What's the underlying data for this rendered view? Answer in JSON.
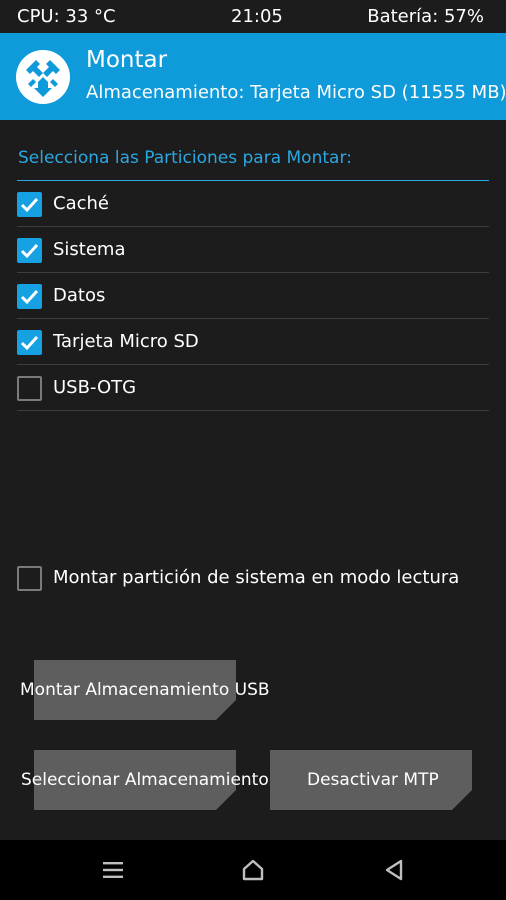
{
  "status_bar": {
    "cpu": "CPU: 33 °C",
    "time": "21:05",
    "battery": "Batería: 57%"
  },
  "header": {
    "title": "Montar",
    "subtitle": "Almacenamiento: Tarjeta Micro SD (11555 MB)",
    "logo_icon": "twrp-logo-icon"
  },
  "partitions": {
    "label": "Selecciona las Particiones para Montar:",
    "items": [
      {
        "label": "Caché",
        "checked": true
      },
      {
        "label": "Sistema",
        "checked": true
      },
      {
        "label": "Datos",
        "checked": true
      },
      {
        "label": "Tarjeta Micro SD",
        "checked": true
      },
      {
        "label": "USB-OTG",
        "checked": false
      }
    ]
  },
  "readonly_option": {
    "label": "Montar partición de sistema en modo lectura",
    "checked": false
  },
  "buttons": {
    "mount_usb": "Montar Almacenamiento USB",
    "select_storage": "Seleccionar Almacenamiento",
    "disable_mtp": "Desactivar MTP"
  },
  "nav": {
    "menu_icon": "menu-icon",
    "home_icon": "home-icon",
    "back_icon": "back-icon"
  },
  "colors": {
    "accent": "#0f9ad9",
    "checkbox": "#16a1e3",
    "button": "#5e5e5e",
    "background": "#1c1c1c"
  }
}
